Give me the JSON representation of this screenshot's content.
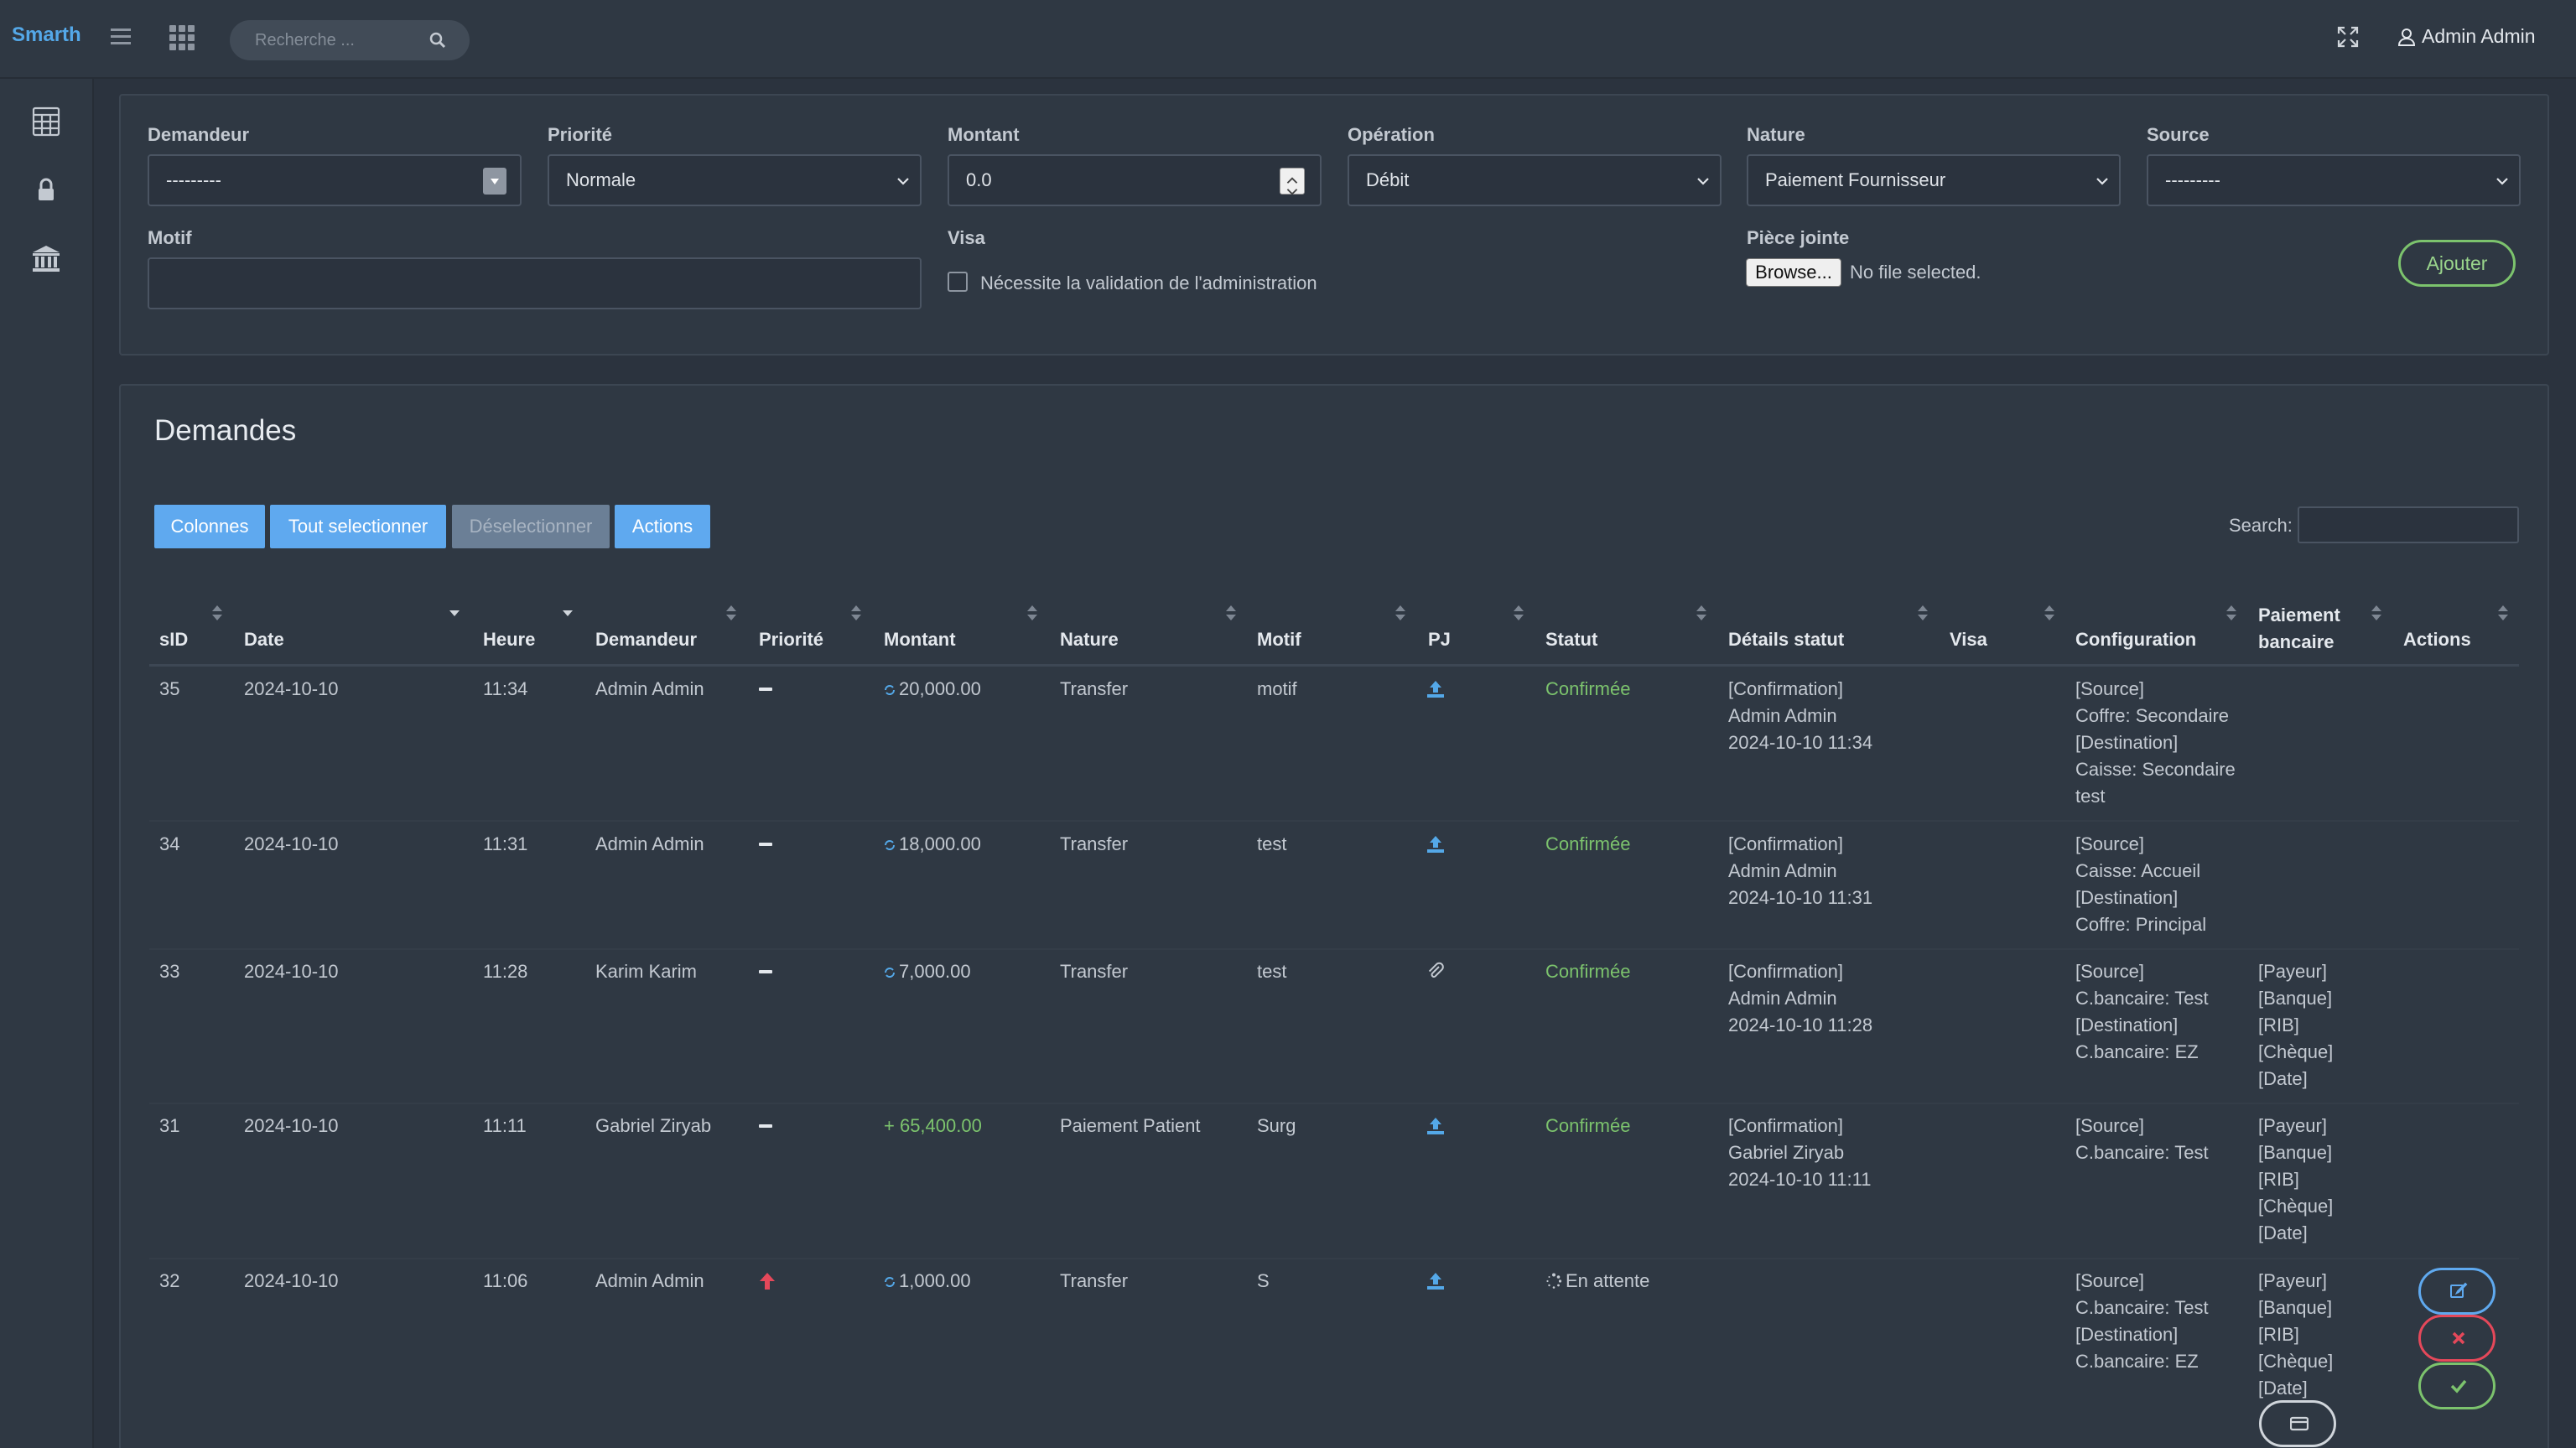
{
  "brand": "Smarth",
  "search": {
    "placeholder": "Recherche ..."
  },
  "user": {
    "name": "Admin Admin"
  },
  "sidebar": {
    "items": [
      "calculator-icon",
      "lock-icon",
      "bank-icon"
    ]
  },
  "form": {
    "demandeur": {
      "label": "Demandeur",
      "value": "---------"
    },
    "priorite": {
      "label": "Priorité",
      "value": "Normale"
    },
    "montant": {
      "label": "Montant",
      "value": "0.0"
    },
    "operation": {
      "label": "Opération",
      "value": "Débit"
    },
    "nature": {
      "label": "Nature",
      "value": "Paiement Fournisseur"
    },
    "source": {
      "label": "Source",
      "value": "---------"
    },
    "motif": {
      "label": "Motif",
      "value": ""
    },
    "visa": {
      "label": "Visa",
      "checkbox_label": "Nécessite la validation de l'administration",
      "checked": false
    },
    "piece_jointe": {
      "label": "Pièce jointe",
      "button": "Browse...",
      "status": "No file selected."
    },
    "submit": "Ajouter"
  },
  "table_card": {
    "title": "Demandes",
    "buttons": [
      "Colonnes",
      "Tout selectionner",
      "Déselectionner",
      "Actions"
    ],
    "search_label": "Search:",
    "columns": [
      "sID",
      "Date",
      "Heure",
      "Demandeur",
      "Priorité",
      "Montant",
      "Nature",
      "Motif",
      "PJ",
      "Statut",
      "Détails statut",
      "Visa",
      "Configuration",
      "Paiement bancaire",
      "Actions"
    ],
    "rows": [
      {
        "sid": "35",
        "date": "2024-10-10",
        "heure": "11:34",
        "demandeur": "Admin Admin",
        "priorite": "normal",
        "montant": "20,000.00",
        "montant_type": "transfer",
        "nature": "Transfer",
        "motif": "motif",
        "pj": "upload-icon",
        "statut": "Confirmée",
        "details": "[Confirmation]\nAdmin Admin\n2024-10-10 11:34",
        "visa": "",
        "configuration": "[Source]\nCoffre: Secondaire\n[Destination]\nCaisse: Secondaire\ntest",
        "paiement": ""
      },
      {
        "sid": "34",
        "date": "2024-10-10",
        "heure": "11:31",
        "demandeur": "Admin Admin",
        "priorite": "normal",
        "montant": "18,000.00",
        "montant_type": "transfer",
        "nature": "Transfer",
        "motif": "test",
        "pj": "upload-icon",
        "statut": "Confirmée",
        "details": "[Confirmation]\nAdmin Admin\n2024-10-10 11:31",
        "visa": "",
        "configuration": "[Source]\nCaisse: Accueil\n[Destination]\nCoffre: Principal",
        "paiement": ""
      },
      {
        "sid": "33",
        "date": "2024-10-10",
        "heure": "11:28",
        "demandeur": "Karim Karim",
        "priorite": "normal",
        "montant": "7,000.00",
        "montant_type": "transfer",
        "nature": "Transfer",
        "motif": "test",
        "pj": "paperclip-icon",
        "statut": "Confirmée",
        "details": "[Confirmation]\nAdmin Admin\n2024-10-10 11:28",
        "visa": "",
        "configuration": "[Source]\nC.bancaire: Test\n[Destination]\nC.bancaire: EZ",
        "paiement": "[Payeur]\n[Banque]\n[RIB]\n[Chèque]\n[Date]"
      },
      {
        "sid": "31",
        "date": "2024-10-10",
        "heure": "11:11",
        "demandeur": "Gabriel Ziryab",
        "priorite": "normal",
        "montant": "+ 65,400.00",
        "montant_type": "credit",
        "nature": "Paiement Patient",
        "motif": "Surg",
        "pj": "upload-icon",
        "statut": "Confirmée",
        "details": "[Confirmation]\nGabriel Ziryab\n2024-10-10 11:11",
        "visa": "",
        "configuration": "[Source]\nC.bancaire: Test",
        "paiement": "[Payeur]\n[Banque]\n[RIB]\n[Chèque]\n[Date]"
      },
      {
        "sid": "32",
        "date": "2024-10-10",
        "heure": "11:06",
        "demandeur": "Admin Admin",
        "priorite": "high",
        "montant": "1,000.00",
        "montant_type": "transfer",
        "nature": "Transfer",
        "motif": "S",
        "pj": "upload-icon",
        "statut": "En attente",
        "details": "",
        "visa": "",
        "configuration": "[Source]\nC.bancaire: Test\n[Destination]\nC.bancaire: EZ",
        "paiement": "[Payeur]\n[Banque]\n[RIB]\n[Chèque]\n[Date]"
      }
    ]
  },
  "colors": {
    "accent": "#5fa9ef",
    "success": "#7cc36d",
    "danger": "#e5485a",
    "brand": "#54a8e8"
  }
}
